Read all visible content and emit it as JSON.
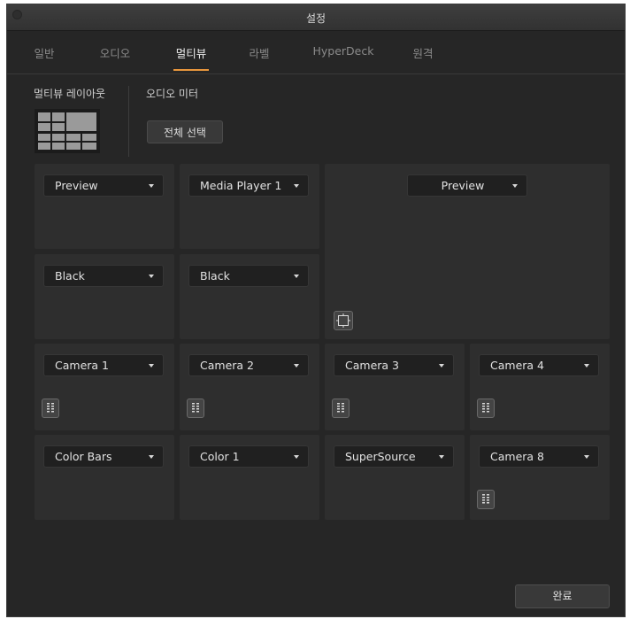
{
  "window": {
    "title": "설정"
  },
  "tabs": [
    {
      "label": "일반"
    },
    {
      "label": "오디오"
    },
    {
      "label": "멀티뷰"
    },
    {
      "label": "라벨"
    },
    {
      "label": "HyperDeck"
    },
    {
      "label": "원격"
    }
  ],
  "active_tab": "멀티뷰",
  "layout_section": {
    "label": "멀티뷰 레이아웃"
  },
  "audio_section": {
    "label": "오디오 미터",
    "select_all_label": "전체 선택"
  },
  "views": {
    "preview_small": "Preview",
    "media_player": "Media Player 1",
    "black_1": "Black",
    "black_2": "Black",
    "program_large": "Preview",
    "camera_1": "Camera 1",
    "camera_2": "Camera 2",
    "camera_3": "Camera 3",
    "camera_4": "Camera 4",
    "color_bars": "Color Bars",
    "color_1": "Color 1",
    "supersource": "SuperSource",
    "camera_8": "Camera 8"
  },
  "footer": {
    "done_label": "완료"
  },
  "colors": {
    "accent": "#e8963c",
    "window_bg": "#262626",
    "panel_bg": "#2e2e2e"
  }
}
